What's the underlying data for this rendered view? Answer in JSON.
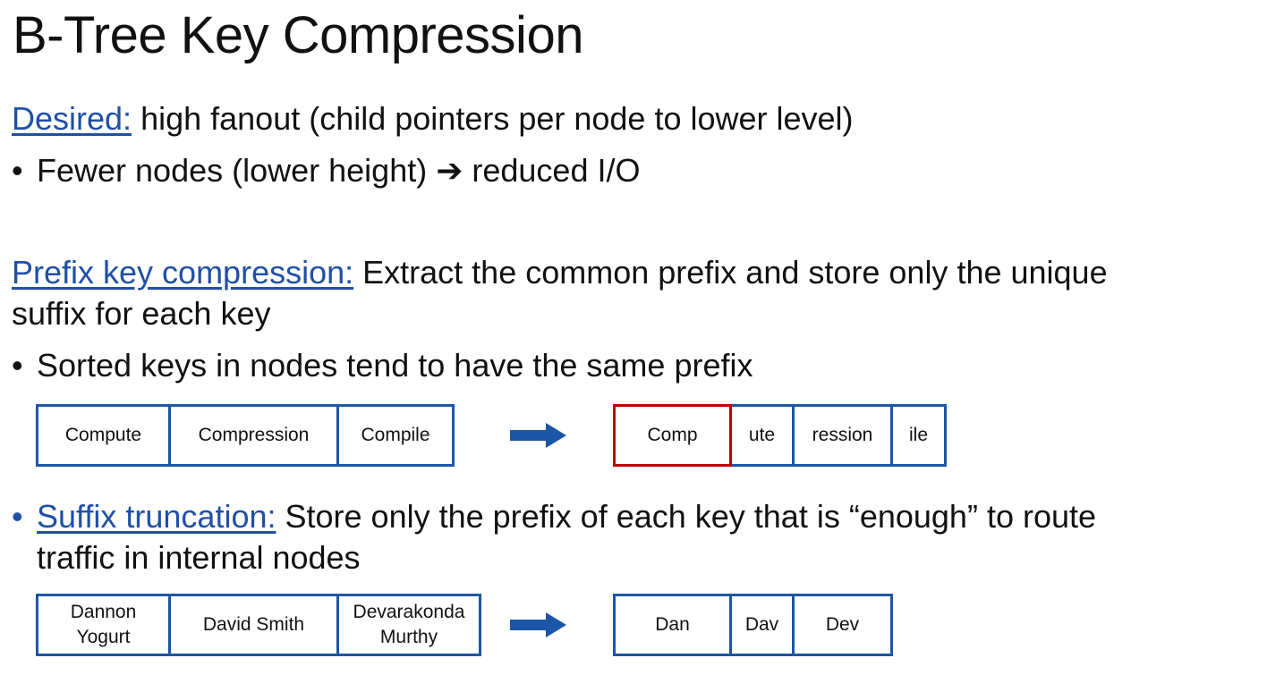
{
  "title": "B-Tree Key Compression",
  "desired": {
    "label": "Desired:",
    "text": " high fanout (child pointers per node to lower level)",
    "bullet_before": "Fewer nodes (lower height) ",
    "arrow_glyph": "➔",
    "bullet_after": " reduced I/O"
  },
  "prefix": {
    "label": "Prefix key compression:",
    "text_line1": " Extract the common prefix and store only the unique",
    "text_line2": "suffix for each key",
    "bullet": "Sorted keys in nodes tend to have the same prefix",
    "before_keys": [
      "Compute",
      "Compression",
      "Compile"
    ],
    "after_keys": [
      "Comp",
      "ute",
      "ression",
      "ile"
    ],
    "highlight_color": "#c00000"
  },
  "suffix": {
    "label": "Suffix truncation:",
    "text_line1": " Store only the prefix of each key that is “enough” to route",
    "text_line2": "traffic in internal nodes",
    "before_keys": [
      "Dannon Yogurt",
      "David Smith",
      "Devarakonda Murthy"
    ],
    "after_keys": [
      "Dan",
      "Dav",
      "Dev"
    ]
  },
  "colors": {
    "accent": "#1f4fa8",
    "box_border": "#1c56a6",
    "arrow": "#1c56a6"
  },
  "bullet_char": "•",
  "icons": {
    "transform_arrow": "right-block-arrow-icon"
  }
}
